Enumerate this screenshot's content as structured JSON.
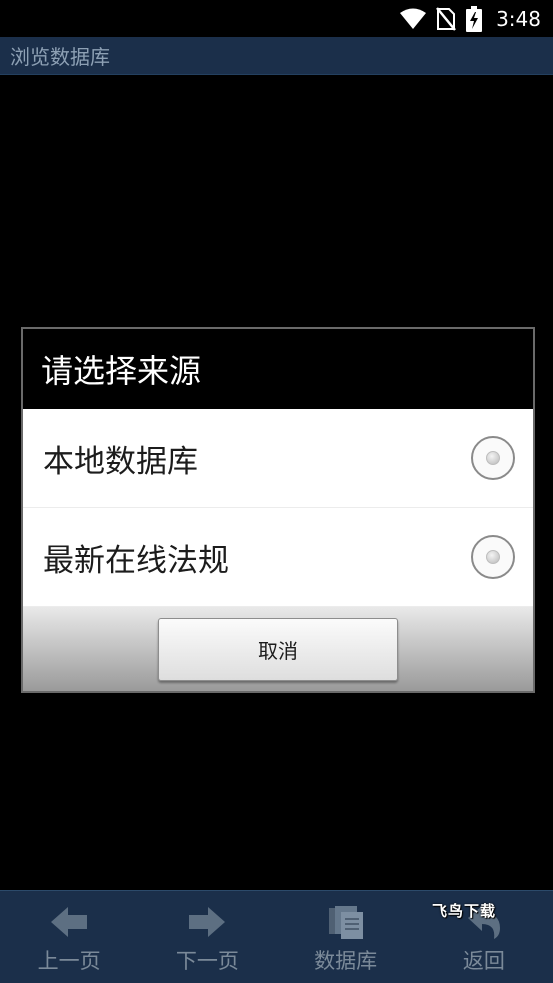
{
  "status_bar": {
    "time": "3:48",
    "icons": [
      "wifi-icon",
      "no-sim-icon",
      "battery-charging-icon"
    ]
  },
  "header": {
    "title": "浏览数据库"
  },
  "dialog": {
    "title": "请选择来源",
    "options": [
      {
        "label": "本地数据库",
        "selected": false
      },
      {
        "label": "最新在线法规",
        "selected": false
      }
    ],
    "cancel_label": "取消"
  },
  "bottom_nav": {
    "items": [
      {
        "label": "上一页",
        "icon": "arrow-left-icon"
      },
      {
        "label": "下一页",
        "icon": "arrow-right-icon"
      },
      {
        "label": "数据库",
        "icon": "database-icon"
      },
      {
        "label": "返回",
        "icon": "return-icon"
      }
    ]
  },
  "watermark": "飞鸟下载",
  "colors": {
    "bar_background": "#1b2f4a",
    "nav_text": "#7b8a99",
    "dialog_body": "#ffffff"
  }
}
